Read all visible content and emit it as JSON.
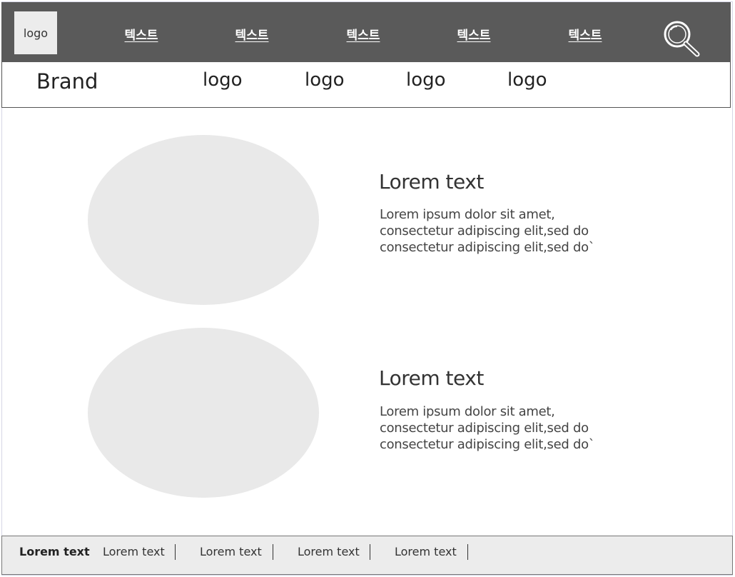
{
  "header": {
    "logo_label": "logo",
    "nav_items": [
      "텍스트",
      "텍스트",
      "텍스트",
      "텍스트",
      "텍스트"
    ],
    "search_icon": "search-icon",
    "background_color": "#5a5a5a"
  },
  "brandbar": {
    "brand_label": "Brand",
    "logos": [
      "logo",
      "logo",
      "logo",
      "logo"
    ]
  },
  "content": {
    "blocks": [
      {
        "title": "Lorem text",
        "lines": [
          "Lorem ipsum dolor sit amet,",
          "consectetur adipiscing elit,sed do",
          "consectetur adipiscing elit,sed do`"
        ]
      },
      {
        "title": "Lorem text",
        "lines": [
          "Lorem ipsum dolor sit amet,",
          "consectetur adipiscing elit,sed do",
          "consectetur adipiscing elit,sed do`"
        ]
      }
    ],
    "placeholder_color": "#e9e9e9"
  },
  "footer": {
    "items": [
      "Lorem text",
      "Lorem text",
      "Lorem text",
      "Lorem text",
      "Lorem text"
    ],
    "background_color": "#ececec"
  }
}
